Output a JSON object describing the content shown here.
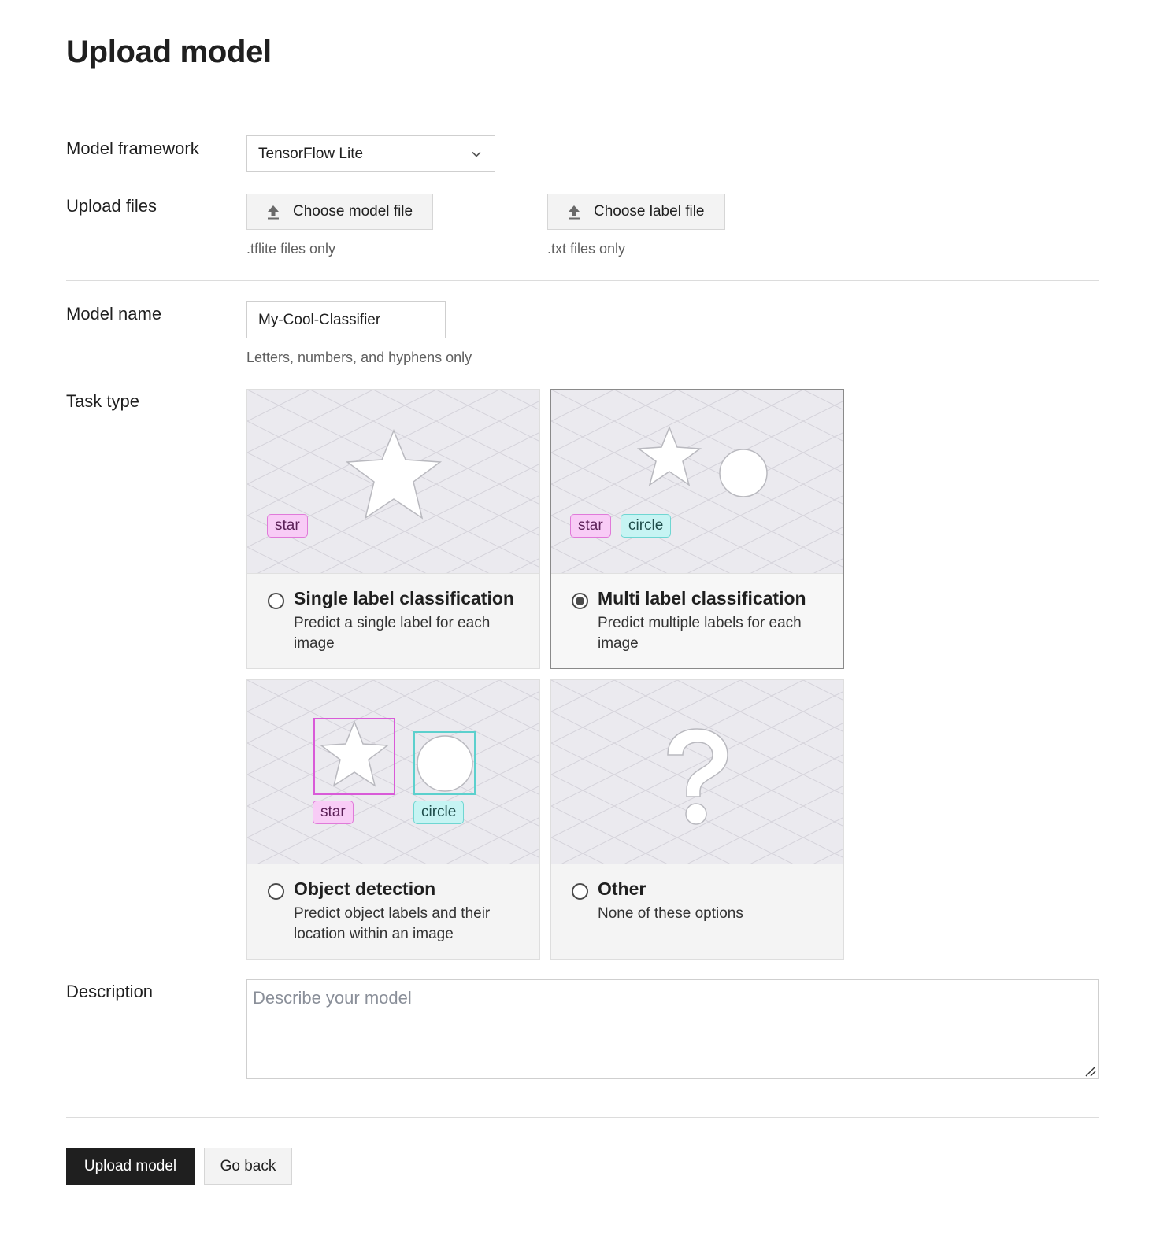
{
  "page": {
    "title": "Upload model"
  },
  "framework": {
    "label": "Model framework",
    "selected": "TensorFlow Lite"
  },
  "upload": {
    "label": "Upload files",
    "model_button": "Choose model file",
    "model_hint": ".tflite files only",
    "label_button": "Choose label file",
    "label_hint": ".txt files only"
  },
  "model_name": {
    "label": "Model name",
    "value": "My-Cool-Classifier",
    "hint": "Letters, numbers, and hyphens only"
  },
  "task_type": {
    "label": "Task type",
    "selected": "multi",
    "options": [
      {
        "id": "single",
        "title": "Single label classification",
        "description": "Predict a single label for each image",
        "tags": [
          "star"
        ]
      },
      {
        "id": "multi",
        "title": "Multi label classification",
        "description": "Predict multiple labels for each image",
        "tags": [
          "star",
          "circle"
        ]
      },
      {
        "id": "detection",
        "title": "Object detection",
        "description": "Predict object labels and their location within an image",
        "tags": [
          "star",
          "circle"
        ]
      },
      {
        "id": "other",
        "title": "Other",
        "description": "None of these options",
        "tags": []
      }
    ]
  },
  "description": {
    "label": "Description",
    "placeholder": "Describe your model",
    "value": ""
  },
  "actions": {
    "submit": "Upload model",
    "back": "Go back"
  },
  "colors": {
    "tag_pink": "#f8ccf6",
    "tag_cyan": "#c6f4f3",
    "primary": "#1f1f1f",
    "illustration_bg": "#ebeaef"
  }
}
